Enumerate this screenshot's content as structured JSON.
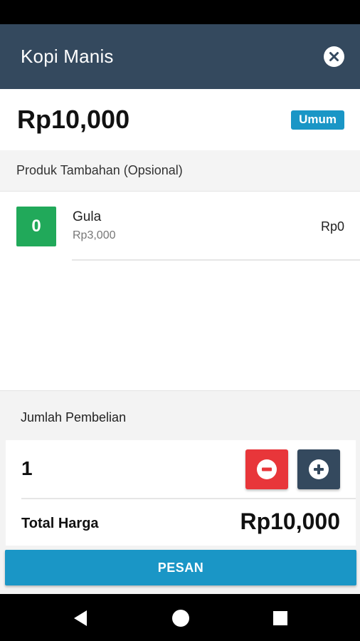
{
  "colors": {
    "header": "#34495e",
    "green": "#21a95a",
    "red": "#e8363a",
    "blue": "#1a96c6"
  },
  "header": {
    "title": "Kopi Manis",
    "close_icon": "close-circle-icon"
  },
  "product": {
    "price": "Rp10,000",
    "badge": "Umum"
  },
  "addons": {
    "section_title": "Produk Tambahan (Opsional)",
    "items": [
      {
        "qty": "0",
        "name": "Gula",
        "unit_price": "Rp3,000",
        "subtotal": "Rp0"
      }
    ]
  },
  "purchase": {
    "label": "Jumlah Pembelian",
    "quantity": "1",
    "minus_icon": "minus-circle-icon",
    "plus_icon": "plus-circle-icon",
    "total_label": "Total Harga",
    "total_value": "Rp10,000"
  },
  "actions": {
    "order_label": "PESAN"
  },
  "navbar": {
    "icons": [
      "back-icon",
      "home-icon",
      "recents-icon"
    ]
  }
}
